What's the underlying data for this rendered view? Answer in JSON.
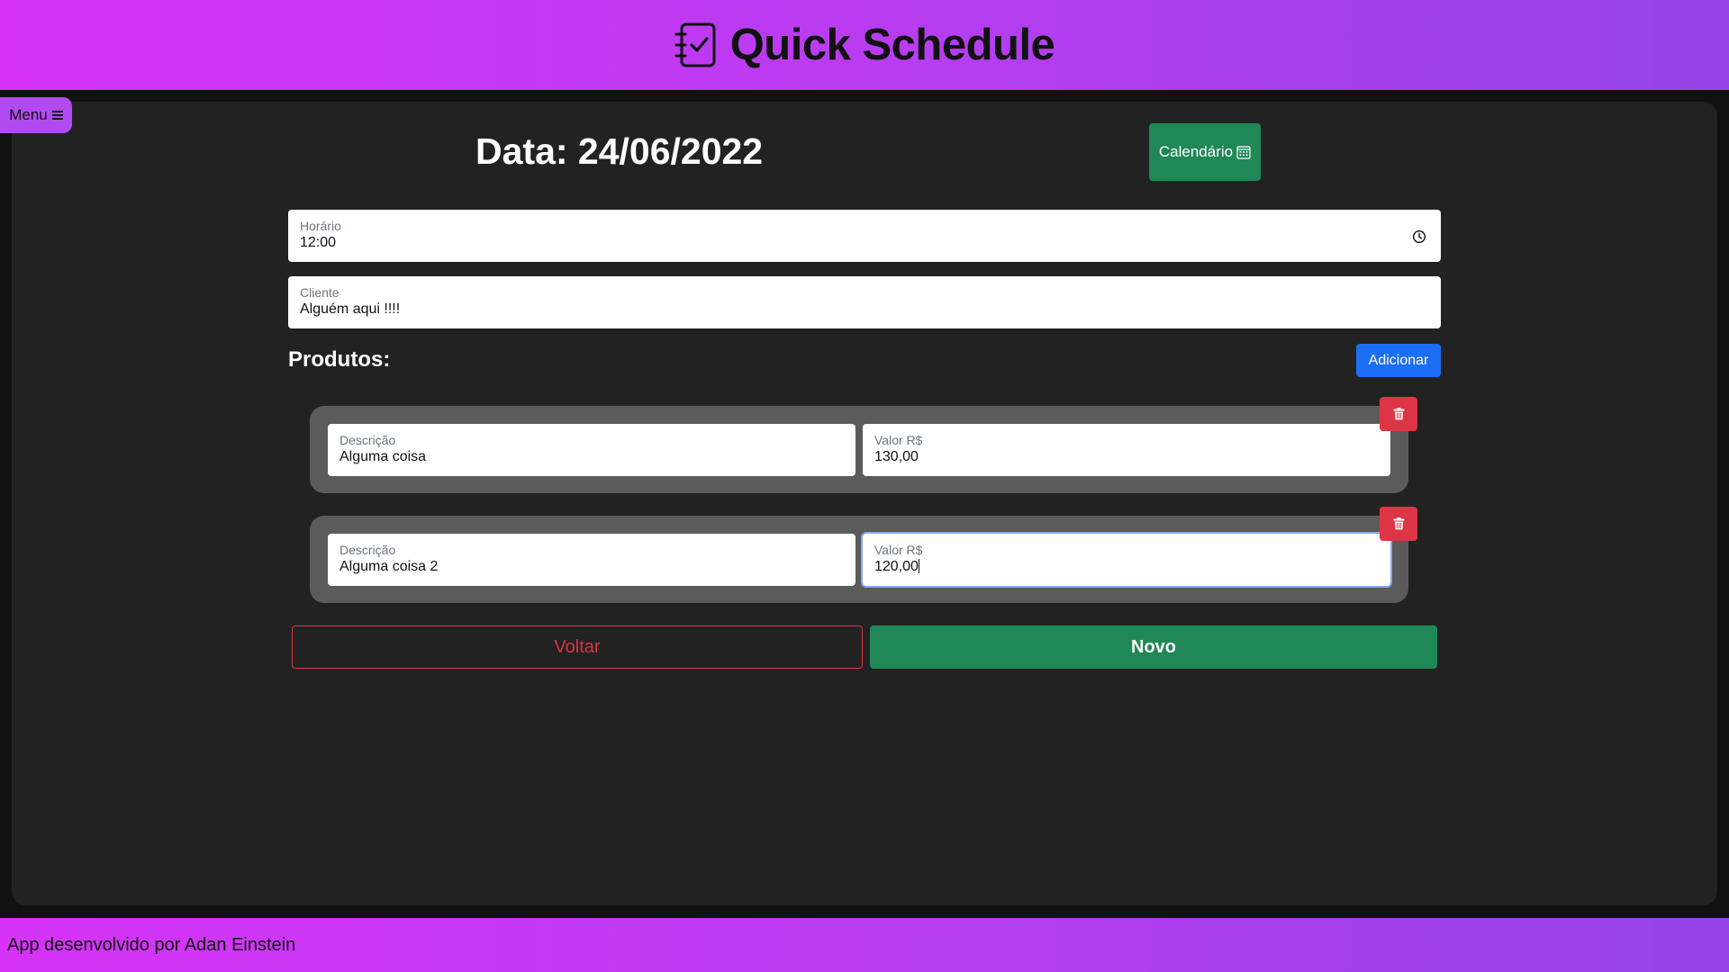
{
  "header": {
    "title": "Quick Schedule",
    "logo_icon": "checklist-notebook-icon"
  },
  "menu": {
    "label": "Menu",
    "icon": "hamburger-icon"
  },
  "page": {
    "date_title": "Data: 24/06/2022",
    "calendar_button": "Calendário",
    "calendar_icon": "calendar-grid-icon"
  },
  "form": {
    "horario": {
      "label": "Horário",
      "value": "12:00"
    },
    "cliente": {
      "label": "Cliente",
      "value": "Alguém aqui !!!!"
    }
  },
  "products": {
    "title": "Produtos:",
    "add_button": "Adicionar",
    "items": [
      {
        "desc_label": "Descrição",
        "desc_value": "Alguma coisa",
        "price_label": "Valor R$",
        "price_value": "130,00"
      },
      {
        "desc_label": "Descrição",
        "desc_value": "Alguma coisa 2",
        "price_label": "Valor R$",
        "price_value": "120,00"
      }
    ]
  },
  "actions": {
    "back": "Voltar",
    "new": "Novo"
  },
  "footer": {
    "text": "App desenvolvido por Adan Einstein"
  },
  "colors": {
    "gradient_start": "#d633f7",
    "gradient_end": "#9443e6",
    "success": "#1f8856",
    "danger": "#dc3545",
    "primary": "#1b6ef5"
  }
}
